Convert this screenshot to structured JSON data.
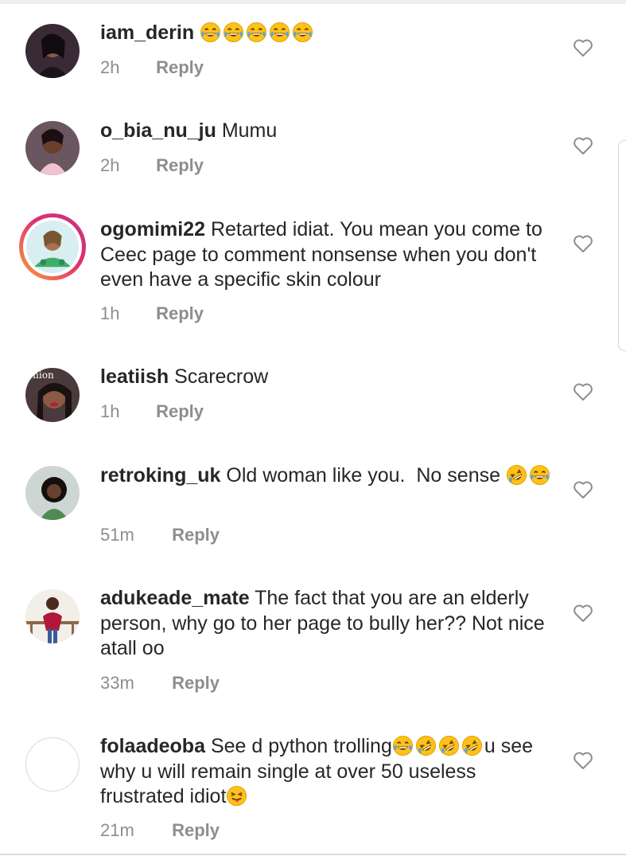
{
  "comments": [
    {
      "username": "iam_derin",
      "text": "",
      "emoji_after": [
        "face-with-tears-of-joy",
        "face-with-tears-of-joy",
        "face-with-tears-of-joy",
        "face-with-tears-of-joy",
        "face-with-tears-of-joy"
      ],
      "time": "2h",
      "reply_label": "Reply"
    },
    {
      "username": "o_bia_nu_ju",
      "text": "Mumu",
      "emoji_after": [],
      "time": "2h",
      "reply_label": "Reply"
    },
    {
      "username": "ogomimi22",
      "text": "Retarted idiat. You mean you come to Ceec page to comment nonsense when you don't even have a specific skin colour",
      "emoji_after": [],
      "time": "1h",
      "reply_label": "Reply"
    },
    {
      "username": "leatiish",
      "text": "Scarecrow",
      "emoji_after": [],
      "time": "1h",
      "reply_label": "Reply"
    },
    {
      "username": "retroking_uk",
      "text": "Old woman like you.  No sense",
      "emoji_after": [
        "rolling-on-floor-laughing",
        "face-with-tears-of-joy"
      ],
      "time": "51m",
      "reply_label": "Reply"
    },
    {
      "username": "adukeade_mate",
      "text": "The fact that you are an elderly person, why go to her page to bully her?? Not nice atall oo",
      "emoji_after": [],
      "time": "33m",
      "reply_label": "Reply"
    },
    {
      "username": "folaadeoba",
      "text": "See d python trolling",
      "emoji_mid": [
        "face-with-tears-of-joy",
        "rolling-on-floor-laughing",
        "rolling-on-floor-laughing",
        "rolling-on-floor-laughing"
      ],
      "text_after": "u see why u will remain single at over 50 useless frustrated idiot",
      "emoji_after": [
        "winking-face-with-tongue"
      ],
      "time": "21m",
      "reply_label": "Reply"
    }
  ],
  "avatar_overlay_text": "shion",
  "icons": {
    "like": "heart-outline-icon"
  },
  "colors": {
    "text": "#262626",
    "meta": "#8e8e8e",
    "story_ring_start": "#f7a23b",
    "story_ring_end": "#c13584"
  }
}
